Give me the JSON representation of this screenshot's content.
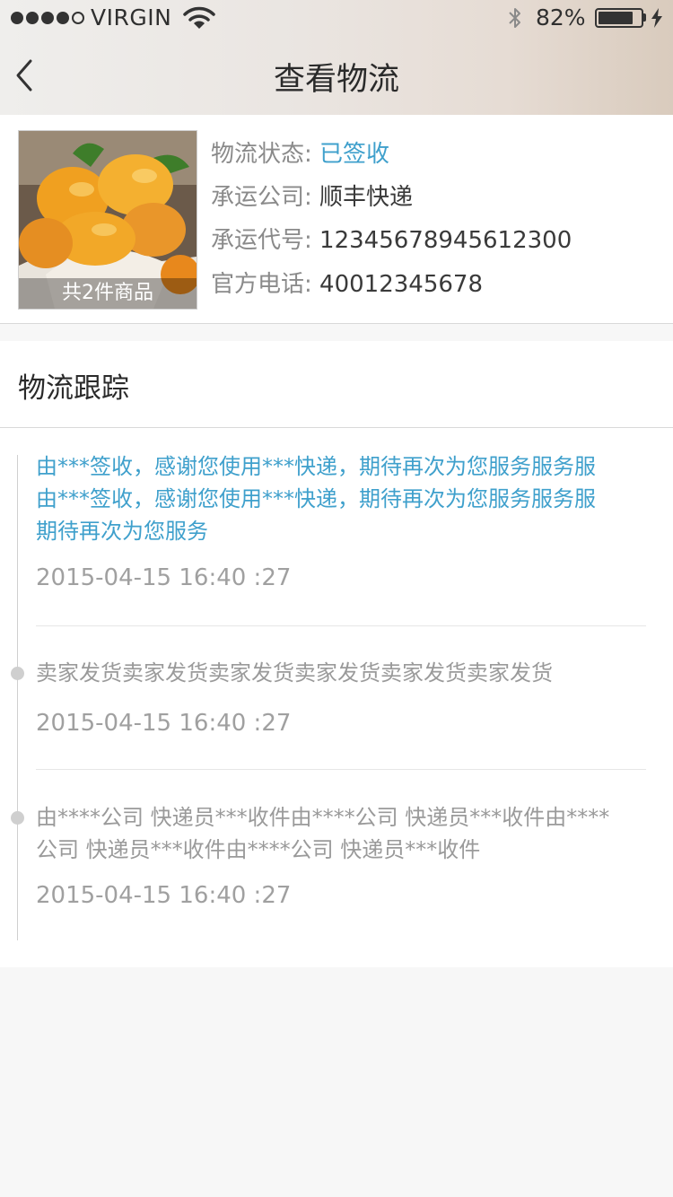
{
  "status_bar": {
    "carrier": "VIRGIN",
    "battery_text": "82%",
    "battery_level": 0.82
  },
  "nav": {
    "title": "查看物流",
    "back_icon": "chevron-left-icon"
  },
  "shipment": {
    "thumbnail_caption": "共2件商品",
    "status_label": "物流状态:",
    "status_value": "已签收",
    "carrier_label": "承运公司:",
    "carrier_value": "顺丰快递",
    "tracking_label": "承运代号:",
    "tracking_value": "12345678945612300",
    "phone_label": "官方电话:",
    "phone_value": "40012345678",
    "highlight_color": "#3fa0cc"
  },
  "tracking": {
    "title": "物流跟踪",
    "events": [
      {
        "text_lines": [
          "由***签收，感谢您使用***快递，期待再次为您服务服务服",
          "由***签收，感谢您使用***快递，期待再次为您服务服务服",
          "期待再次为您服务"
        ],
        "time": "2015-04-15 16:40 :27",
        "active": true
      },
      {
        "text_lines": [
          "卖家发货卖家发货卖家发货卖家发货卖家发货卖家发货"
        ],
        "time": "2015-04-15 16:40 :27",
        "active": false
      },
      {
        "text_lines": [
          "由****公司 快递员***收件由****公司 快递员***收件由****",
          "公司 快递员***收件由****公司 快递员***收件"
        ],
        "time": "2015-04-15 16:40 :27",
        "active": false
      }
    ]
  }
}
